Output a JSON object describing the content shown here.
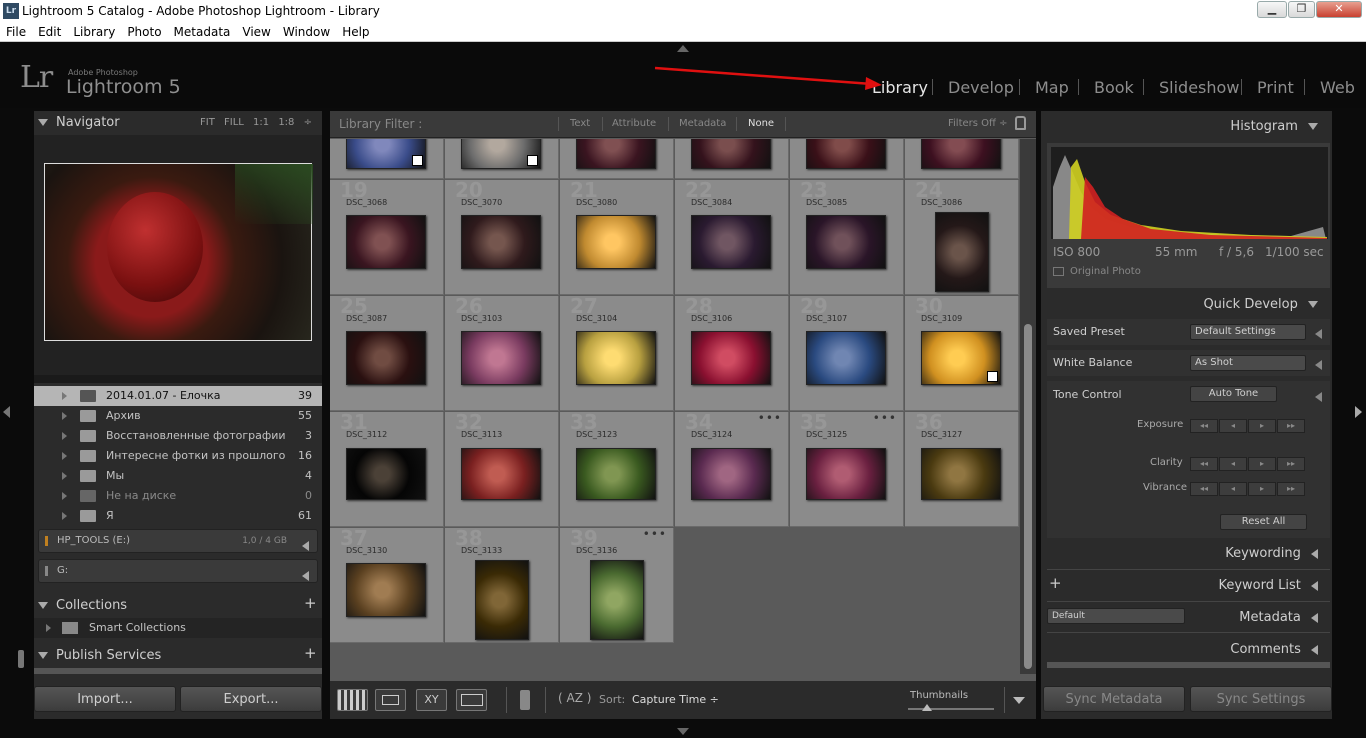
{
  "window": {
    "title": "Lightroom 5 Catalog - Adobe Photoshop Lightroom - Library",
    "app_icon": "Lr",
    "minimize": "▁",
    "maximize": "❐",
    "close": "✕"
  },
  "menu": [
    "File",
    "Edit",
    "Library",
    "Photo",
    "Metadata",
    "View",
    "Window",
    "Help"
  ],
  "identity": {
    "logo": "Lr",
    "brand": "Adobe Photoshop",
    "product": "Lightroom 5"
  },
  "modules": [
    "Library",
    "Develop",
    "Map",
    "Book",
    "Slideshow",
    "Print",
    "Web"
  ],
  "active_module": "Library",
  "navigator": {
    "title": "Navigator",
    "zoom": [
      "FIT",
      "FILL",
      "1:1",
      "1:8"
    ]
  },
  "folders": [
    {
      "name": "2014.01.07 - Елочка",
      "count": "39",
      "selected": true
    },
    {
      "name": "Архив",
      "count": "55"
    },
    {
      "name": "Восстановленные фотографии",
      "count": "3"
    },
    {
      "name": "Интересне фотки из прошлого",
      "count": "16"
    },
    {
      "name": "Мы",
      "count": "4"
    },
    {
      "name": "Не на диске",
      "count": "0",
      "missing": true
    },
    {
      "name": "Я",
      "count": "61"
    }
  ],
  "volumes": [
    {
      "name": "HP_TOOLS (E:)",
      "info": "1,0 / 4 GB"
    },
    {
      "name": "G:",
      "info": ""
    }
  ],
  "collections": {
    "title": "Collections",
    "smart": "Smart Collections",
    "add": "+"
  },
  "publish": {
    "title": "Publish Services",
    "add": "+"
  },
  "buttons": {
    "import": "Import...",
    "export": "Export..."
  },
  "filter_bar": {
    "label": "Library Filter :",
    "options": [
      "Text",
      "Attribute",
      "Metadata",
      "None"
    ],
    "active": "None",
    "preset": "Filters Off ÷"
  },
  "grid": {
    "row0": [
      {
        "num": "",
        "name": "",
        "color": "#3a4c8a"
      },
      {
        "num": "",
        "name": "",
        "color": "#6c6c6c"
      },
      {
        "num": "",
        "name": "",
        "color": "#3a1420"
      },
      {
        "num": "",
        "name": "",
        "color": "#34121c"
      },
      {
        "num": "",
        "name": "",
        "color": "#3a1018"
      },
      {
        "num": "",
        "name": "",
        "color": "#3d1020"
      }
    ],
    "row1": [
      {
        "num": "19",
        "name": "DSC_3068",
        "color": "#3a1520"
      },
      {
        "num": "20",
        "name": "DSC_3070",
        "color": "#2f1a1c"
      },
      {
        "num": "21",
        "name": "DSC_3080",
        "color": "#c08a30"
      },
      {
        "num": "22",
        "name": "DSC_3084",
        "color": "#2a1a30"
      },
      {
        "num": "23",
        "name": "DSC_3085",
        "color": "#2a1528"
      },
      {
        "num": "24",
        "name": "DSC_3086",
        "color": "#241818"
      }
    ],
    "row2": [
      {
        "num": "25",
        "name": "DSC_3087",
        "color": "#2a1010"
      },
      {
        "num": "26",
        "name": "DSC_3103",
        "color": "#7a3b60"
      },
      {
        "num": "27",
        "name": "DSC_3104",
        "color": "#b8a040"
      },
      {
        "num": "28",
        "name": "DSC_3106",
        "color": "#8a1030"
      },
      {
        "num": "29",
        "name": "DSC_3107",
        "color": "#2a4a80"
      },
      {
        "num": "30",
        "name": "DSC_3109",
        "color": "#d09020"
      }
    ],
    "row3": [
      {
        "num": "31",
        "name": "DSC_3112",
        "color": "#050505"
      },
      {
        "num": "32",
        "name": "DSC_3113",
        "color": "#7a2020"
      },
      {
        "num": "33",
        "name": "DSC_3123",
        "color": "#3a5a20"
      },
      {
        "num": "34",
        "name": "DSC_3124",
        "color": "#5a2a50"
      },
      {
        "num": "35",
        "name": "DSC_3125",
        "color": "#6a2040"
      },
      {
        "num": "36",
        "name": "DSC_3127",
        "color": "#4a3a10"
      }
    ],
    "row4": [
      {
        "num": "37",
        "name": "DSC_3130",
        "color": "#5a4020"
      },
      {
        "num": "38",
        "name": "DSC_3133",
        "color": "#3a2a05"
      },
      {
        "num": "39",
        "name": "DSC_3136",
        "color": "#4a6a30"
      }
    ]
  },
  "toolbar": {
    "sort_label": "Sort:",
    "sort_value": "Capture Time ÷",
    "thumbnails": "Thumbnails"
  },
  "histogram": {
    "title": "Histogram",
    "iso": "ISO 800",
    "focal": "55 mm",
    "aperture": "f / 5,6",
    "shutter": "1/100 sec",
    "original": "Original Photo"
  },
  "quick_develop": {
    "title": "Quick Develop",
    "saved_preset_label": "Saved Preset",
    "saved_preset_value": "Default Settings",
    "wb_label": "White Balance",
    "wb_value": "As Shot",
    "tone_label": "Tone Control",
    "auto_tone": "Auto Tone",
    "exposure": "Exposure",
    "clarity": "Clarity",
    "vibrance": "Vibrance",
    "reset": "Reset All"
  },
  "right_sections": {
    "keywording": "Keywording",
    "keyword_list": "Keyword List",
    "metadata": "Metadata",
    "metadata_preset": "Default",
    "comments": "Comments",
    "plus": "+"
  },
  "sync": {
    "metadata": "Sync Metadata",
    "settings": "Sync Settings"
  },
  "colors": {
    "accent_arrow": "#e01010",
    "panel": "#2b2b2b",
    "grid_bg": "#5a5a5a",
    "cell": "#8b8b8b"
  }
}
